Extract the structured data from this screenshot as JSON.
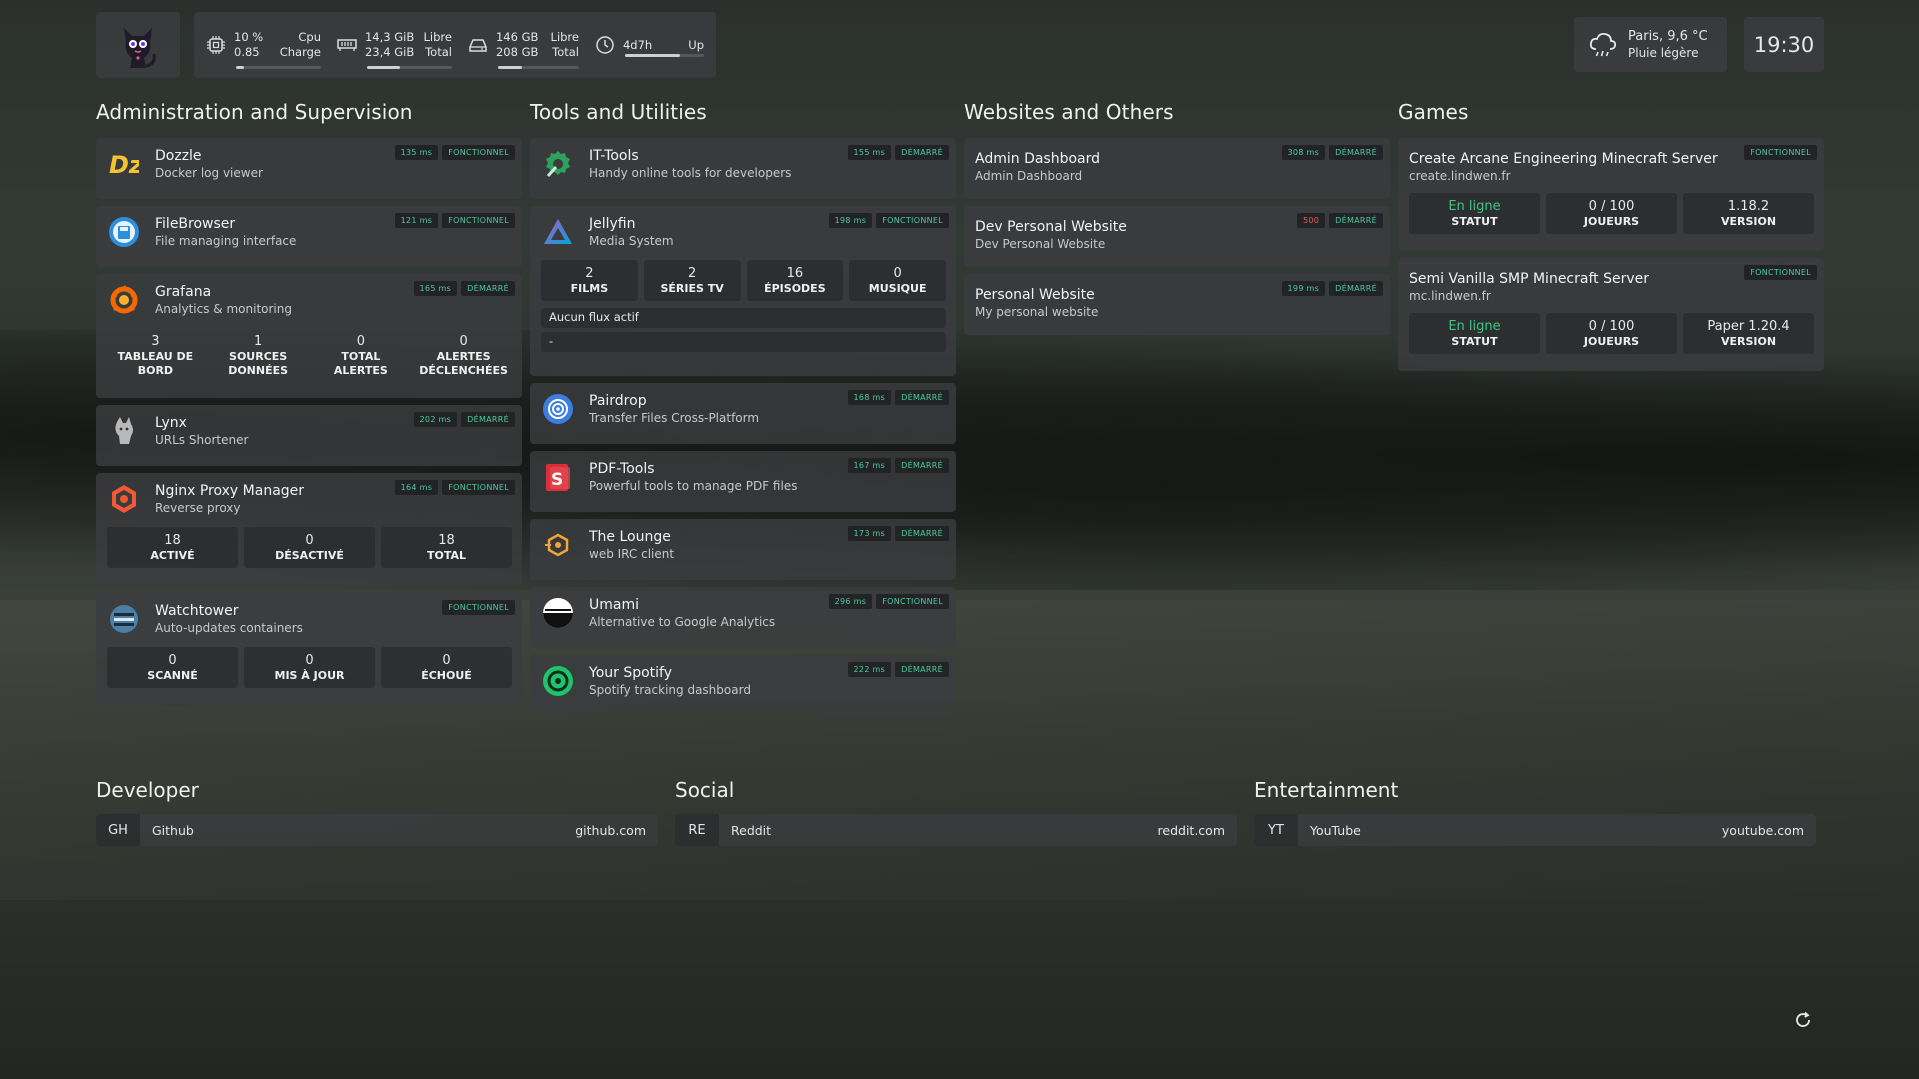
{
  "topbar": {
    "cpu": {
      "usage": "10 %",
      "load": "0.85",
      "label1": "Cpu",
      "label2": "Charge",
      "fill": 0.1
    },
    "ram": {
      "free": "14,3 GiB",
      "total": "23,4 GiB",
      "label1": "Libre",
      "label2": "Total",
      "fill": 0.39
    },
    "disk": {
      "free": "146 GB",
      "total": "208 GB",
      "label1": "Libre",
      "label2": "Total",
      "fill": 0.3
    },
    "uptime": {
      "value": "4d7h",
      "label": "Up",
      "fill": 0.7
    },
    "weather": {
      "line1": "Paris, 9,6 °C",
      "line2": "Pluie légère"
    },
    "clock": "19:30"
  },
  "sections": {
    "admin": {
      "title": "Administration and Supervision",
      "dozzle": {
        "name": "Dozzle",
        "desc": "Docker log viewer",
        "ping": "135 ms",
        "status": "FONCTIONNEL"
      },
      "filebrowser": {
        "name": "FileBrowser",
        "desc": "File managing interface",
        "ping": "121 ms",
        "status": "FONCTIONNEL"
      },
      "grafana": {
        "name": "Grafana",
        "desc": "Analytics & monitoring",
        "ping": "165 ms",
        "status": "DÉMARRÉ",
        "stats": [
          {
            "v": "3",
            "l": "TABLEAU DE BORD"
          },
          {
            "v": "1",
            "l": "SOURCES DONNÉES"
          },
          {
            "v": "0",
            "l": "TOTAL ALERTES"
          },
          {
            "v": "0",
            "l": "ALERTES DÉCLENCHÉES"
          }
        ]
      },
      "lynx": {
        "name": "Lynx",
        "desc": "URLs Shortener",
        "ping": "202 ms",
        "status": "DÉMARRÉ"
      },
      "npm": {
        "name": "Nginx Proxy Manager",
        "desc": "Reverse proxy",
        "ping": "164 ms",
        "status": "FONCTIONNEL",
        "stats": [
          {
            "v": "18",
            "l": "ACTIVÉ"
          },
          {
            "v": "0",
            "l": "DÉSACTIVÉ"
          },
          {
            "v": "18",
            "l": "TOTAL"
          }
        ]
      },
      "watchtower": {
        "name": "Watchtower",
        "desc": "Auto-updates containers",
        "status": "FONCTIONNEL",
        "stats": [
          {
            "v": "0",
            "l": "SCANNÉ"
          },
          {
            "v": "0",
            "l": "MIS À JOUR"
          },
          {
            "v": "0",
            "l": "ÉCHOUÉ"
          }
        ]
      }
    },
    "tools": {
      "title": "Tools and Utilities",
      "ittools": {
        "name": "IT-Tools",
        "desc": "Handy online tools for developers",
        "ping": "155 ms",
        "status": "DÉMARRÉ"
      },
      "jellyfin": {
        "name": "Jellyfin",
        "desc": "Media System",
        "ping": "198 ms",
        "status": "FONCTIONNEL",
        "stats": [
          {
            "v": "2",
            "l": "FILMS"
          },
          {
            "v": "2",
            "l": "SÉRIES TV"
          },
          {
            "v": "16",
            "l": "ÉPISODES"
          },
          {
            "v": "0",
            "l": "MUSIQUE"
          }
        ],
        "stream": "Aucun flux actif",
        "stream2": "-"
      },
      "pairdrop": {
        "name": "Pairdrop",
        "desc": "Transfer Files Cross-Platform",
        "ping": "168 ms",
        "status": "DÉMARRÉ"
      },
      "pdftools": {
        "name": "PDF-Tools",
        "desc": "Powerful tools to manage PDF files",
        "ping": "167 ms",
        "status": "DÉMARRÉ"
      },
      "lounge": {
        "name": "The Lounge",
        "desc": "web IRC client",
        "ping": "173 ms",
        "status": "DÉMARRÉ"
      },
      "umami": {
        "name": "Umami",
        "desc": "Alternative to Google Analytics",
        "ping": "296 ms",
        "status": "FONCTIONNEL"
      },
      "spotify": {
        "name": "Your Spotify",
        "desc": "Spotify tracking dashboard",
        "ping": "222 ms",
        "status": "DÉMARRÉ"
      }
    },
    "websites": {
      "title": "Websites and Others",
      "admin": {
        "name": "Admin Dashboard",
        "desc": "Admin Dashboard",
        "ping": "308 ms",
        "status": "DÉMARRÉ"
      },
      "dev": {
        "name": "Dev Personal Website",
        "desc": "Dev Personal Website",
        "ping": "500",
        "status": "DÉMARRÉ"
      },
      "personal": {
        "name": "Personal Website",
        "desc": "My personal website",
        "ping": "199 ms",
        "status": "DÉMARRÉ"
      }
    },
    "games": {
      "title": "Games",
      "create": {
        "name": "Create Arcane Engineering Minecraft Server",
        "desc": "create.lindwen.fr",
        "status": "FONCTIONNEL",
        "stats": [
          {
            "v": "En ligne",
            "l": "STATUT"
          },
          {
            "v": "0 / 100",
            "l": "JOUEURS"
          },
          {
            "v": "1.18.2",
            "l": "VERSION"
          }
        ]
      },
      "smp": {
        "name": "Semi Vanilla SMP Minecraft Server",
        "desc": "mc.lindwen.fr",
        "status": "FONCTIONNEL",
        "stats": [
          {
            "v": "En ligne",
            "l": "STATUT"
          },
          {
            "v": "0 / 100",
            "l": "JOUEURS"
          },
          {
            "v": "Paper 1.20.4",
            "l": "VERSION"
          }
        ]
      }
    }
  },
  "bookmarks": {
    "developer": {
      "title": "Developer",
      "abbr": "GH",
      "name": "Github",
      "url": "github.com"
    },
    "social": {
      "title": "Social",
      "abbr": "RE",
      "name": "Reddit",
      "url": "reddit.com"
    },
    "entertainment": {
      "title": "Entertainment",
      "abbr": "YT",
      "name": "YouTube",
      "url": "youtube.com"
    }
  },
  "colors": {
    "accent": "#4ccc9a",
    "online": "#3fc77e",
    "error": "#f05a5a",
    "card": "#3a3c3e"
  },
  "icons": [
    "cat-logo-icon",
    "cpu-icon",
    "memory-icon",
    "disk-icon",
    "clock-icon",
    "weather-rain-icon",
    "refresh-icon"
  ]
}
